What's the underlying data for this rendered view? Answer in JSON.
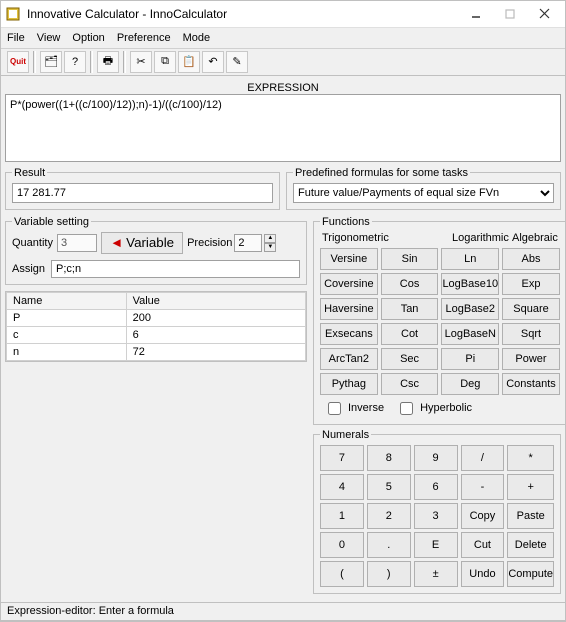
{
  "window": {
    "title": "Innovative Calculator - InnoCalculator"
  },
  "menu": {
    "items": [
      "File",
      "View",
      "Option",
      "Preference",
      "Mode"
    ]
  },
  "toolbar": {
    "quit_label": "Quit",
    "icons": [
      "explorer-icon",
      "help-icon",
      "print-icon",
      "cut-icon",
      "copy-icon",
      "paste-icon",
      "undo-icon",
      "wand-icon"
    ]
  },
  "expression": {
    "label": "EXPRESSION",
    "value": "P*(power((1+((c/100)/12));n)-1)/((c/100)/12)"
  },
  "result": {
    "legend": "Result",
    "value": "17 281.77"
  },
  "predef": {
    "legend": "Predefined formulas for some tasks",
    "selected": "Future value/Payments of equal size FVn"
  },
  "varset": {
    "legend": "Variable setting",
    "quantity_label": "Quantity",
    "quantity_value": "3",
    "variable_btn": "Variable",
    "precision_label": "Precision",
    "precision_value": "2",
    "assign_label": "Assign",
    "assign_value": "P;c;n",
    "table": {
      "headers": [
        "Name",
        "Value"
      ],
      "rows": [
        {
          "name": "P",
          "value": "200"
        },
        {
          "name": "c",
          "value": "6"
        },
        {
          "name": "n",
          "value": "72"
        }
      ]
    }
  },
  "functions": {
    "legend": "Functions",
    "cols": [
      "Trigonometric",
      "Logarithmic",
      "Algebraic"
    ],
    "grid": [
      [
        "Versine",
        "Sin",
        "Ln",
        "Abs"
      ],
      [
        "Coversine",
        "Cos",
        "LogBase10",
        "Exp"
      ],
      [
        "Haversine",
        "Tan",
        "LogBase2",
        "Square"
      ],
      [
        "Exsecans",
        "Cot",
        "LogBaseN",
        "Sqrt"
      ],
      [
        "ArcTan2",
        "Sec",
        "Pi",
        "Power"
      ],
      [
        "Pythag",
        "Csc",
        "Deg",
        "Constants"
      ]
    ],
    "inverse_label": "Inverse",
    "hyperbolic_label": "Hyperbolic"
  },
  "numerals": {
    "legend": "Numerals",
    "grid": [
      [
        "7",
        "8",
        "9",
        "/",
        "*"
      ],
      [
        "4",
        "5",
        "6",
        "-",
        "+"
      ],
      [
        "1",
        "2",
        "3",
        "Copy",
        "Paste"
      ],
      [
        "0",
        ".",
        "E",
        "Cut",
        "Delete"
      ],
      [
        "(",
        ")",
        "±",
        "Undo",
        "Compute"
      ]
    ]
  },
  "status": {
    "text": "Expression-editor: Enter a formula"
  }
}
